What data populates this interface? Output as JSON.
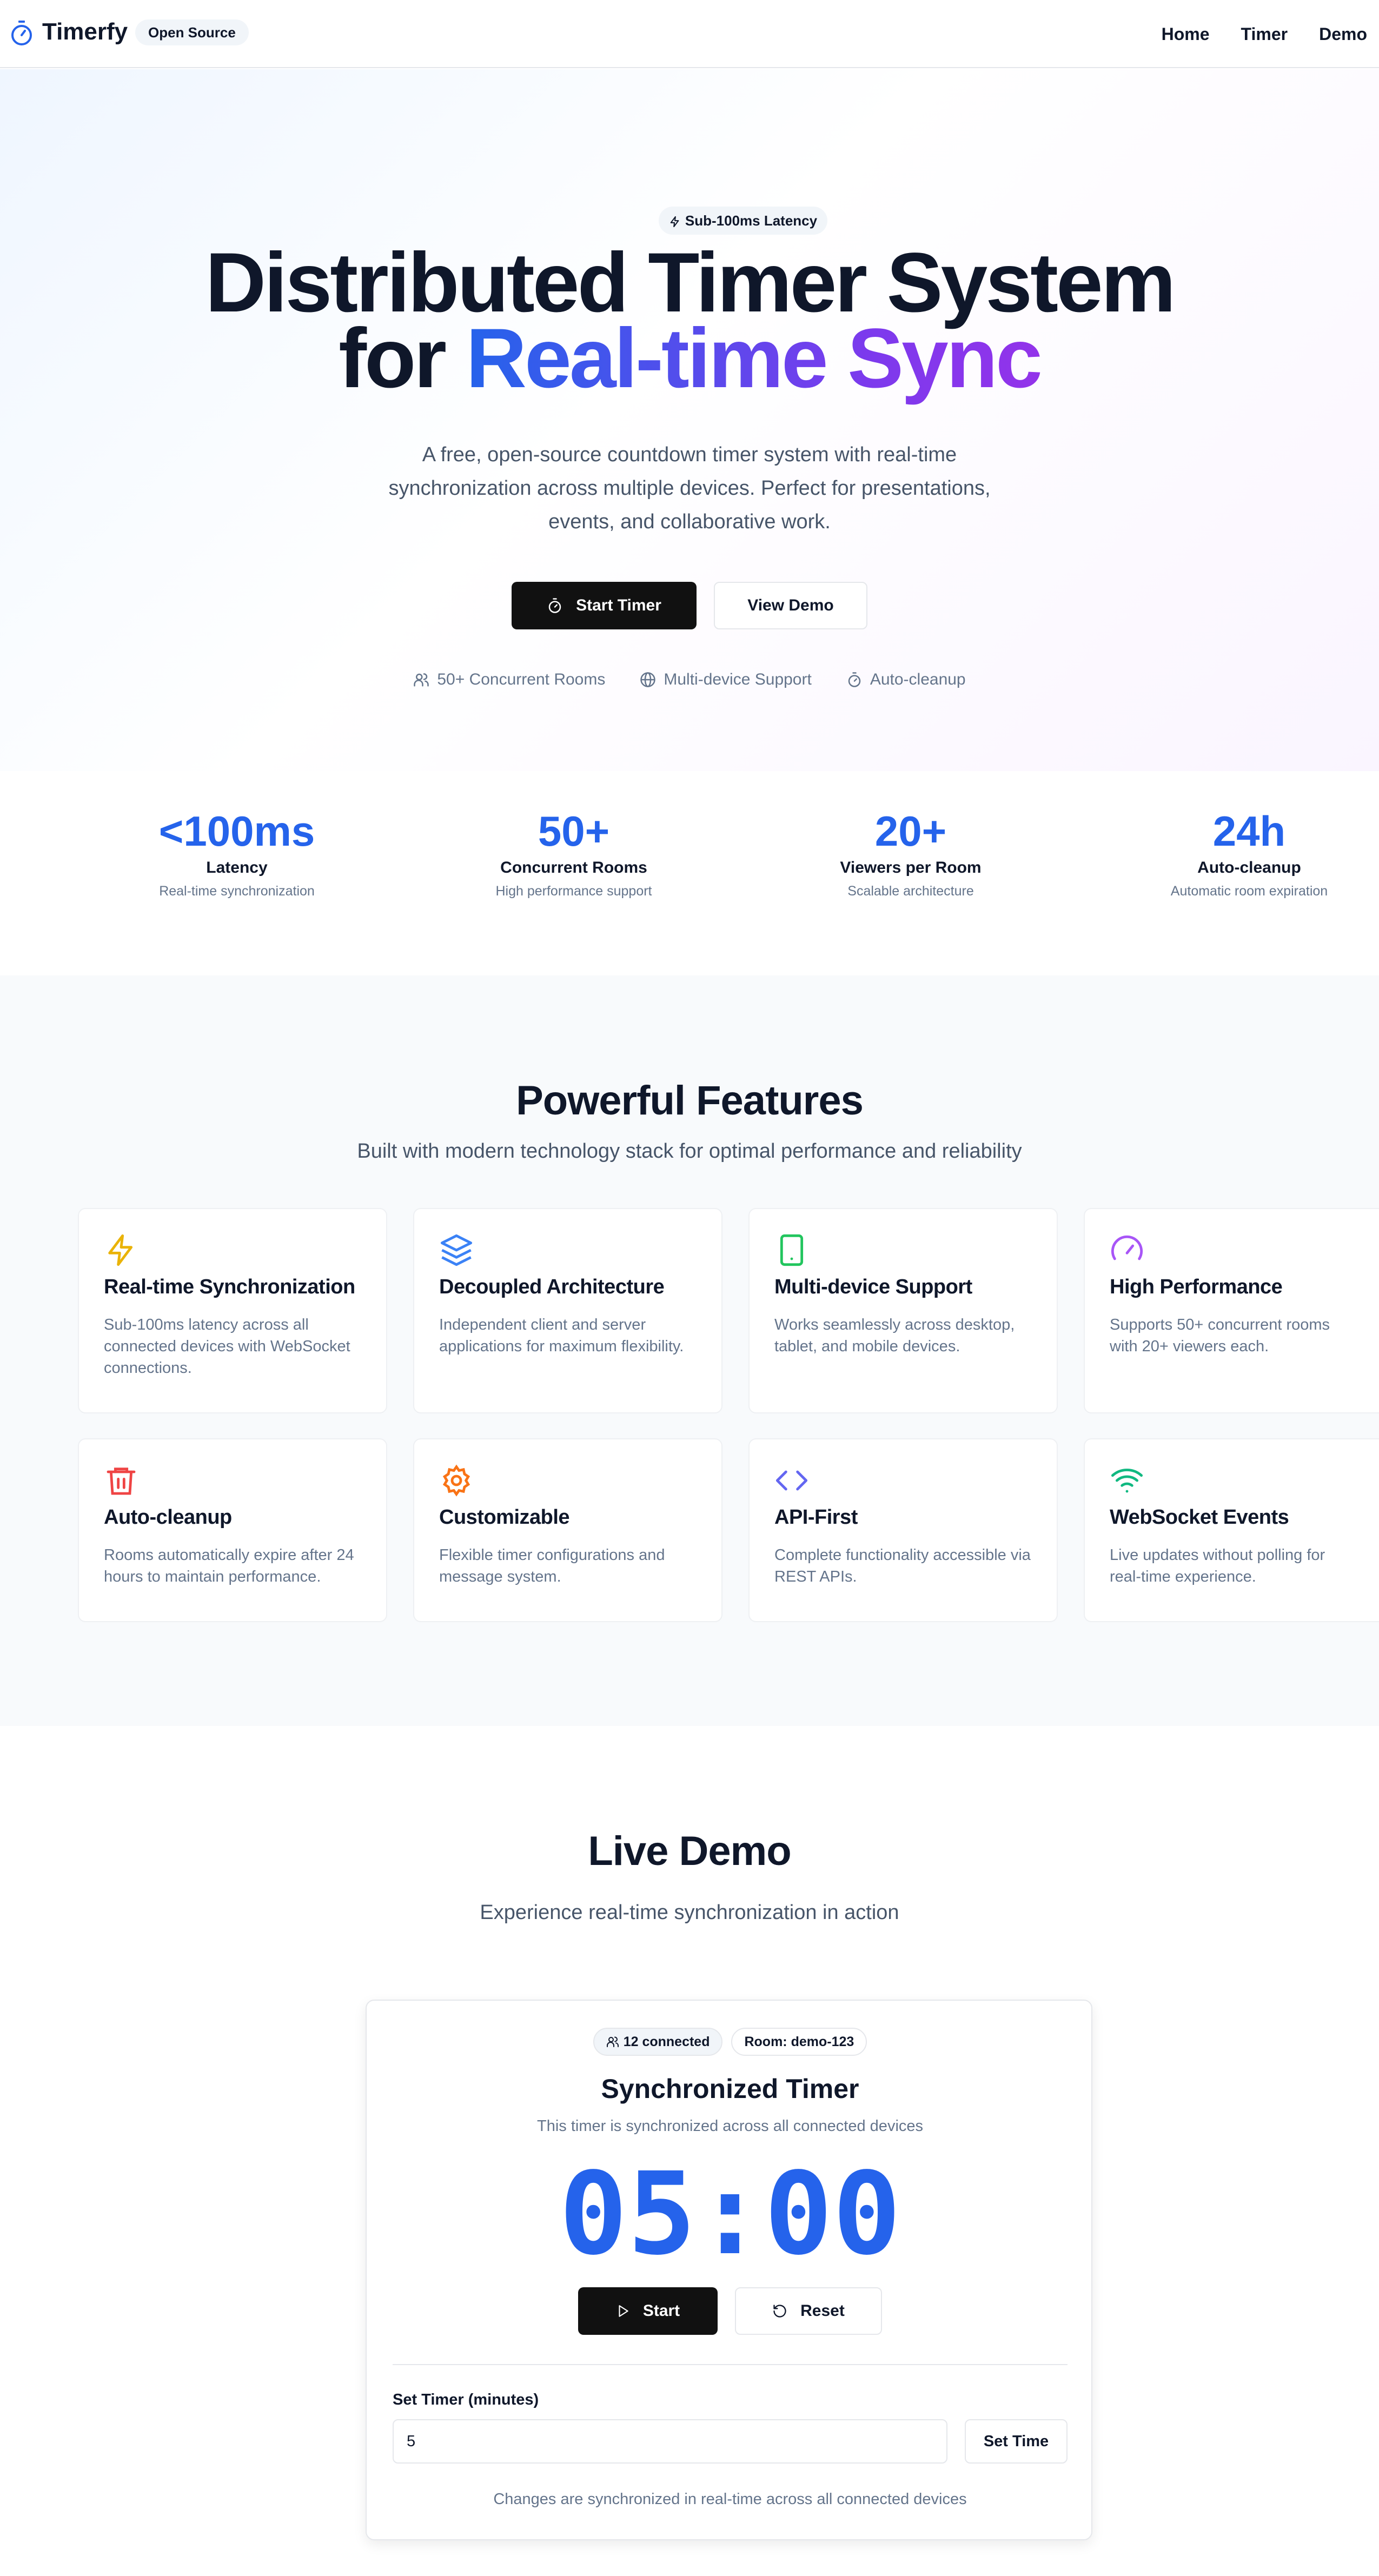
{
  "nav": {
    "brand": "Timerfy",
    "badge": "Open Source",
    "links": [
      "Home",
      "Timer",
      "Demo"
    ]
  },
  "hero": {
    "pill": "Sub-100ms Latency",
    "title_line1": "Distributed Timer System",
    "title_for": "for",
    "title_highlight": "Real-time Sync",
    "description": "A free, open-source countdown timer system with real-time synchronization across multiple devices. Perfect for presentations, events, and collaborative work.",
    "primary_button": "Start Timer",
    "secondary_button": "View Demo",
    "features": [
      "50+ Concurrent Rooms",
      "Multi-device Support",
      "Auto-cleanup"
    ]
  },
  "stats": [
    {
      "value": "<100ms",
      "label": "Latency",
      "sub": "Real-time synchronization"
    },
    {
      "value": "50+",
      "label": "Concurrent Rooms",
      "sub": "High performance support"
    },
    {
      "value": "20+",
      "label": "Viewers per Room",
      "sub": "Scalable architecture"
    },
    {
      "value": "24h",
      "label": "Auto-cleanup",
      "sub": "Automatic room expiration"
    }
  ],
  "features": {
    "title": "Powerful Features",
    "subtitle": "Built with modern technology stack for optimal performance and reliability",
    "cards": [
      {
        "title": "Real-time Synchronization",
        "desc": "Sub-100ms latency across all connected devices with WebSocket connections.",
        "icon": "zap-icon",
        "color": "#eab308"
      },
      {
        "title": "Decoupled Architecture",
        "desc": "Independent client and server applications for maximum flexibility.",
        "icon": "layers-icon",
        "color": "#3b82f6"
      },
      {
        "title": "Multi-device Support",
        "desc": "Works seamlessly across desktop, tablet, and mobile devices.",
        "icon": "tablet-icon",
        "color": "#22c55e"
      },
      {
        "title": "High Performance",
        "desc": "Supports 50+ concurrent rooms with 20+ viewers each.",
        "icon": "gauge-icon",
        "color": "#a855f7"
      },
      {
        "title": "Auto-cleanup",
        "desc": "Rooms automatically expire after 24 hours to maintain performance.",
        "icon": "trash-icon",
        "color": "#ef4444"
      },
      {
        "title": "Customizable",
        "desc": "Flexible timer configurations and message system.",
        "icon": "gear-icon",
        "color": "#f97316"
      },
      {
        "title": "API-First",
        "desc": "Complete functionality accessible via REST APIs.",
        "icon": "code-icon",
        "color": "#6366f1"
      },
      {
        "title": "WebSocket Events",
        "desc": "Live updates without polling for real-time experience.",
        "icon": "wifi-icon",
        "color": "#10b981"
      }
    ]
  },
  "demo": {
    "title": "Live Demo",
    "subtitle": "Experience real-time synchronization in action",
    "connected": "12 connected",
    "room": "Room: demo-123",
    "panel_title": "Synchronized Timer",
    "panel_sub": "This timer is synchronized across all connected devices",
    "time": "05:00",
    "start_button": "Start",
    "reset_button": "Reset",
    "field_label": "Set Timer (minutes)",
    "field_value": "5",
    "set_button": "Set Time",
    "footer": "Changes are synchronized in real-time across all connected devices"
  },
  "colors": {
    "accent": "#2563eb",
    "accent_purple": "#9333ea",
    "dark_button": "#111111"
  }
}
